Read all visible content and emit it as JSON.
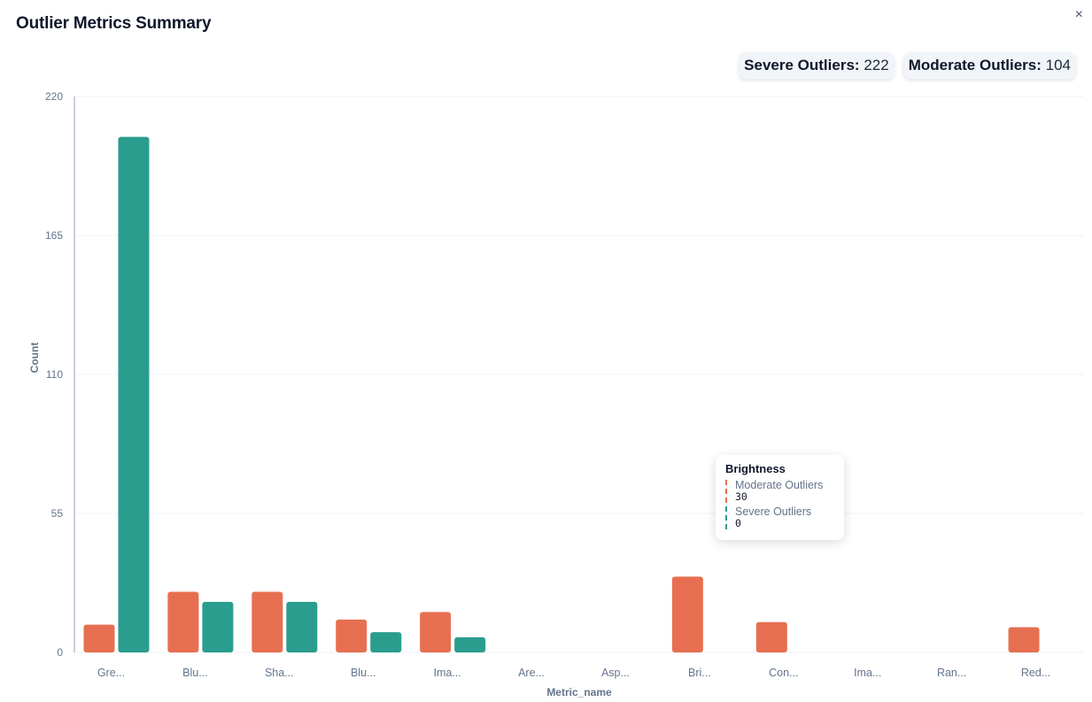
{
  "title": "Outlier Metrics Summary",
  "close_symbol": "×",
  "badges": {
    "severe_label": "Severe Outliers:",
    "severe_value": "222",
    "moderate_label": "Moderate Outliers:",
    "moderate_value": "104"
  },
  "colors": {
    "moderate": "#e76f51",
    "severe": "#2a9d8f"
  },
  "tooltip": {
    "title": "Brightness",
    "items": [
      {
        "name": "Moderate Outliers",
        "value": "30"
      },
      {
        "name": "Severe Outliers",
        "value": "0"
      }
    ]
  },
  "chart_data": {
    "type": "bar",
    "categories": [
      "Gre...",
      "Blu...",
      "Sha...",
      "Blu...",
      "Ima...",
      "Are...",
      "Asp...",
      "Bri...",
      "Con...",
      "Ima...",
      "Ran...",
      "Red..."
    ],
    "series": [
      {
        "name": "Moderate Outliers",
        "values": [
          11,
          24,
          24,
          13,
          16,
          0,
          0,
          30,
          12,
          0,
          0,
          10
        ]
      },
      {
        "name": "Severe Outliers",
        "values": [
          204,
          20,
          20,
          8,
          6,
          0,
          0,
          0,
          0,
          0,
          0,
          0
        ]
      }
    ],
    "xlabel": "Metric_name",
    "ylabel": "Count",
    "yticks": [
      0,
      55,
      110,
      165,
      220
    ],
    "ylim": [
      0,
      220
    ],
    "grid": true
  }
}
